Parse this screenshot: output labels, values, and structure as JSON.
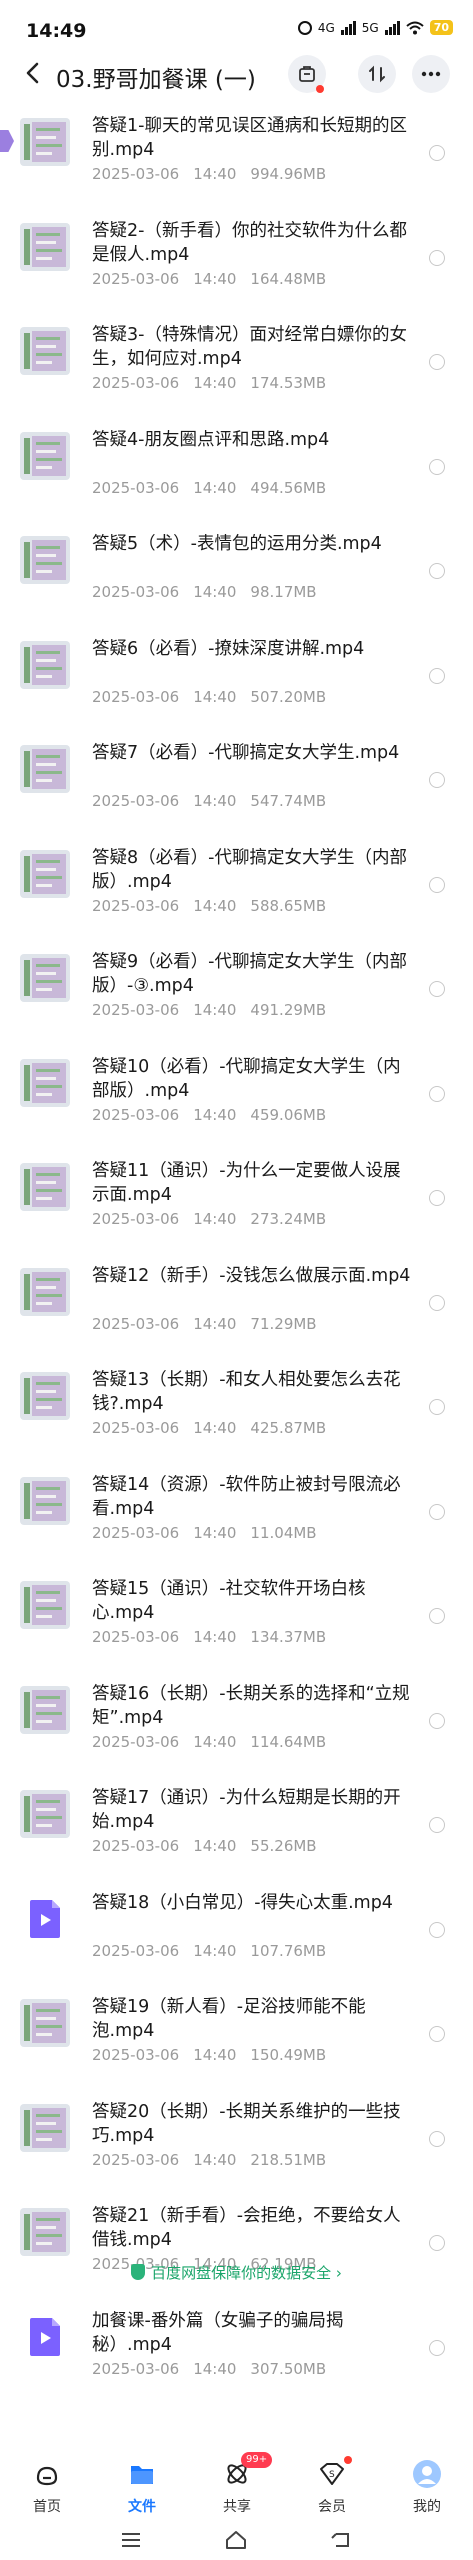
{
  "status_bar": {
    "time": "14:49",
    "network": "4G",
    "network2": "5G",
    "battery": "70"
  },
  "header": {
    "title": "03.野哥加餐课 (一)"
  },
  "files": [
    {
      "name": "答疑1-聊天的常见误区通病和长短期的区别.mp4",
      "date": "2025-03-06",
      "time": "14:40",
      "size": "994.96MB",
      "thumb": "screenshot"
    },
    {
      "name": "答疑2-（新手看）你的社交软件为什么都是假人.mp4",
      "date": "2025-03-06",
      "time": "14:40",
      "size": "164.48MB",
      "thumb": "screenshot"
    },
    {
      "name": "答疑3-（特殊情况）面对经常白嫖你的女生，如何应对.mp4",
      "date": "2025-03-06",
      "time": "14:40",
      "size": "174.53MB",
      "thumb": "screenshot"
    },
    {
      "name": "答疑4-朋友圈点评和思路.mp4",
      "date": "2025-03-06",
      "time": "14:40",
      "size": "494.56MB",
      "thumb": "screenshot"
    },
    {
      "name": "答疑5（术）-表情包的运用分类.mp4",
      "date": "2025-03-06",
      "time": "14:40",
      "size": "98.17MB",
      "thumb": "screenshot"
    },
    {
      "name": "答疑6（必看）-撩妹深度讲解.mp4",
      "date": "2025-03-06",
      "time": "14:40",
      "size": "507.20MB",
      "thumb": "screenshot"
    },
    {
      "name": "答疑7（必看）-代聊搞定女大学生.mp4",
      "date": "2025-03-06",
      "time": "14:40",
      "size": "547.74MB",
      "thumb": "screenshot"
    },
    {
      "name": "答疑8（必看）-代聊搞定女大学生（内部版）.mp4",
      "date": "2025-03-06",
      "time": "14:40",
      "size": "588.65MB",
      "thumb": "screenshot"
    },
    {
      "name": "答疑9（必看）-代聊搞定女大学生（内部版）-③.mp4",
      "date": "2025-03-06",
      "time": "14:40",
      "size": "491.29MB",
      "thumb": "screenshot"
    },
    {
      "name": "答疑10（必看）-代聊搞定女大学生（内部版）.mp4",
      "date": "2025-03-06",
      "time": "14:40",
      "size": "459.06MB",
      "thumb": "screenshot"
    },
    {
      "name": "答疑11（通识）-为什么一定要做人设展示面.mp4",
      "date": "2025-03-06",
      "time": "14:40",
      "size": "273.24MB",
      "thumb": "screenshot"
    },
    {
      "name": "答疑12（新手）-没钱怎么做展示面.mp4",
      "date": "2025-03-06",
      "time": "14:40",
      "size": "71.29MB",
      "thumb": "screenshot"
    },
    {
      "name": "答疑13（长期）-和女人相处要怎么去花钱?.mp4",
      "date": "2025-03-06",
      "time": "14:40",
      "size": "425.87MB",
      "thumb": "screenshot"
    },
    {
      "name": "答疑14（资源）-软件防止被封号限流必看.mp4",
      "date": "2025-03-06",
      "time": "14:40",
      "size": "11.04MB",
      "thumb": "screenshot"
    },
    {
      "name": "答疑15（通识）-社交软件开场白核心.mp4",
      "date": "2025-03-06",
      "time": "14:40",
      "size": "134.37MB",
      "thumb": "screenshot"
    },
    {
      "name": "答疑16（长期）-长期关系的选择和“立规矩”.mp4",
      "date": "2025-03-06",
      "time": "14:40",
      "size": "114.64MB",
      "thumb": "screenshot"
    },
    {
      "name": "答疑17（通识）-为什么短期是长期的开始.mp4",
      "date": "2025-03-06",
      "time": "14:40",
      "size": "55.26MB",
      "thumb": "screenshot"
    },
    {
      "name": "答疑18（小白常见）-得失心太重.mp4",
      "date": "2025-03-06",
      "time": "14:40",
      "size": "107.76MB",
      "thumb": "video"
    },
    {
      "name": "答疑19（新人看）-足浴技师能不能泡.mp4",
      "date": "2025-03-06",
      "time": "14:40",
      "size": "150.49MB",
      "thumb": "screenshot"
    },
    {
      "name": "答疑20（长期）-长期关系维护的一些技巧.mp4",
      "date": "2025-03-06",
      "time": "14:40",
      "size": "218.51MB",
      "thumb": "screenshot"
    },
    {
      "name": "答疑21（新手看）-会拒绝，不要给女人借钱.mp4",
      "date": "2025-03-06",
      "time": "14:40",
      "size": "62.19MB",
      "thumb": "screenshot"
    },
    {
      "name": "加餐课-番外篇（女骗子的骗局揭秘）.mp4",
      "date": "2025-03-06",
      "time": "14:40",
      "size": "307.50MB",
      "thumb": "video"
    }
  ],
  "footer_note": "百度网盘保障你的数据安全",
  "tabs": [
    {
      "label": "首页",
      "icon": "home-icon"
    },
    {
      "label": "文件",
      "icon": "folder-icon",
      "active": true
    },
    {
      "label": "共享",
      "icon": "share-icon",
      "badge": "99+"
    },
    {
      "label": "会员",
      "icon": "vip-icon"
    },
    {
      "label": "我的",
      "icon": "avatar-icon"
    }
  ],
  "colors": {
    "accent": "#1a78ff",
    "safe_green": "#1aa56a",
    "badge_red": "#ff3b50",
    "video_purple": "#7b61ff"
  }
}
